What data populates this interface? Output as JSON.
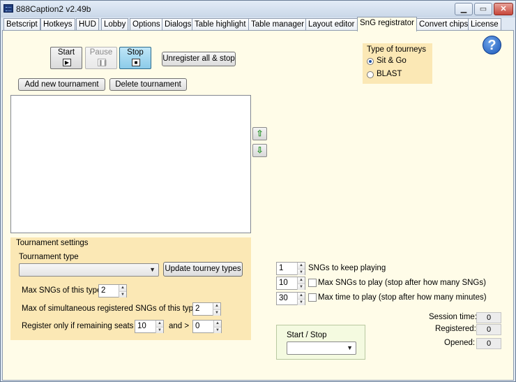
{
  "window": {
    "title": "888Caption2 v2.49b",
    "minimize": "▁",
    "restore": "▭",
    "close": "✕"
  },
  "tabs": [
    "Betscript",
    "Hotkeys",
    "HUD",
    "Lobby",
    "Options",
    "Dialogs",
    "Table highlight",
    "Table manager",
    "Layout editor",
    "SnG registrator",
    "Convert chips",
    "License"
  ],
  "active_tab": "SnG registrator",
  "controls": {
    "start": "Start",
    "pause": "Pause",
    "stop": "Stop",
    "unregister_all": "Unregister all & stop",
    "add_tournament": "Add new tournament",
    "delete_tournament": "Delete tournament",
    "move_up": "⇧",
    "move_down": "⇩"
  },
  "tourney_type_group": {
    "label": "Type of tourneys",
    "options": [
      "Sit & Go",
      "BLAST"
    ],
    "selected": "Sit & Go"
  },
  "help": "?",
  "tournament_settings": {
    "label": "Tournament settings",
    "tournament_type_label": "Tournament type",
    "tournament_type_value": "",
    "update_button": "Update tourney types",
    "max_sngs_label": "Max SNGs of this type",
    "max_sngs_value": "2",
    "max_simultaneous_label": "Max of simultaneous registered SNGs of this type",
    "max_simultaneous_value": "2",
    "remaining_label": "Register only if remaining seats <",
    "remaining_lt_value": "10",
    "and_label": "and >",
    "remaining_gt_value": "0"
  },
  "session_limits": {
    "keep_playing_value": "1",
    "keep_playing_label": "SNGs to keep playing",
    "max_sngs_value": "10",
    "max_sngs_label": "Max SNGs to play (stop after how many SNGs)",
    "max_time_value": "30",
    "max_time_label": "Max time to play (stop after how many minutes)"
  },
  "start_stop": {
    "label": "Start / Stop",
    "value": ""
  },
  "stats": {
    "session_time_label": "Session time:",
    "session_time": "0",
    "registered_label": "Registered:",
    "registered": "0",
    "opened_label": "Opened:",
    "opened": "0"
  }
}
